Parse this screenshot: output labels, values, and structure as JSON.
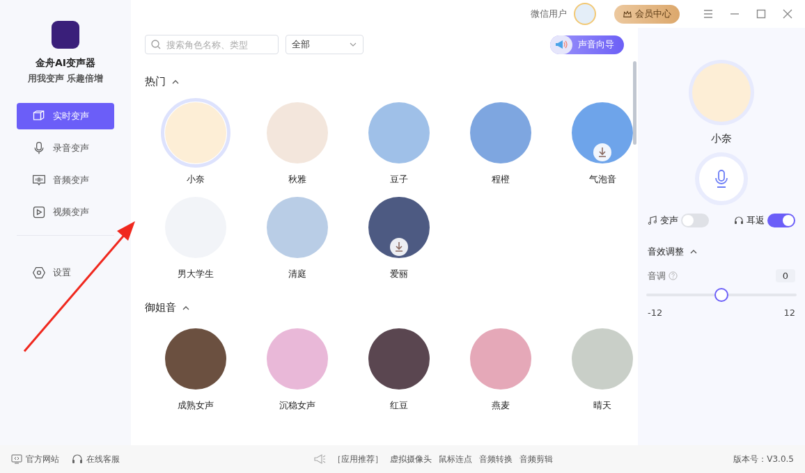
{
  "sidebar": {
    "app_name": "金舟AI变声器",
    "slogan": "用我变声 乐趣倍增",
    "nav": [
      {
        "label": "实时变声",
        "selected": true
      },
      {
        "label": "录音变声",
        "selected": false
      },
      {
        "label": "音频变声",
        "selected": false
      },
      {
        "label": "视频变声",
        "selected": false
      }
    ],
    "settings": {
      "label": "设置"
    }
  },
  "topbar": {
    "user_name": "微信用户",
    "vip_button": "会员中心"
  },
  "toolbar": {
    "search": {
      "placeholder": "搜索角色名称、类型"
    },
    "filter": {
      "value": "全部"
    },
    "guide_button": "声音向导"
  },
  "sections": [
    {
      "title": "热门",
      "expanded": true,
      "voices": [
        {
          "name": "小奈",
          "selected": true,
          "needs_download": false
        },
        {
          "name": "秋雅",
          "selected": false,
          "needs_download": false
        },
        {
          "name": "豆子",
          "selected": false,
          "needs_download": false
        },
        {
          "name": "程橙",
          "selected": false,
          "needs_download": false
        },
        {
          "name": "气泡音",
          "selected": false,
          "needs_download": true
        },
        {
          "name": "男大学生",
          "selected": false,
          "needs_download": false
        },
        {
          "name": "清庭",
          "selected": false,
          "needs_download": false
        },
        {
          "name": "爱丽",
          "selected": false,
          "needs_download": true
        }
      ]
    },
    {
      "title": "御姐音",
      "expanded": true,
      "voices": [
        {
          "name": "成熟女声",
          "selected": false,
          "needs_download": false
        },
        {
          "name": "沉稳女声",
          "selected": false,
          "needs_download": false
        },
        {
          "name": "红豆",
          "selected": false,
          "needs_download": false
        },
        {
          "name": "燕麦",
          "selected": false,
          "needs_download": false
        },
        {
          "name": "晴天",
          "selected": false,
          "needs_download": false
        }
      ]
    }
  ],
  "panel": {
    "voice_name": "小奈",
    "toggles": [
      {
        "label": "变声",
        "on": false
      },
      {
        "label": "耳返",
        "on": true
      }
    ],
    "effects": {
      "title": "音效调整",
      "expanded": true,
      "pitch": {
        "label": "音调",
        "value": "0",
        "level": 0.5,
        "min": "-12",
        "max": "12"
      }
    }
  },
  "footer": {
    "links": [
      "官方网站",
      "在线客服"
    ],
    "recommend_label": "［应用推荐］",
    "apps": [
      "虚拟摄像头",
      "鼠标连点",
      "音频转换",
      "音频剪辑"
    ],
    "version": "版本号：V3.0.5"
  }
}
